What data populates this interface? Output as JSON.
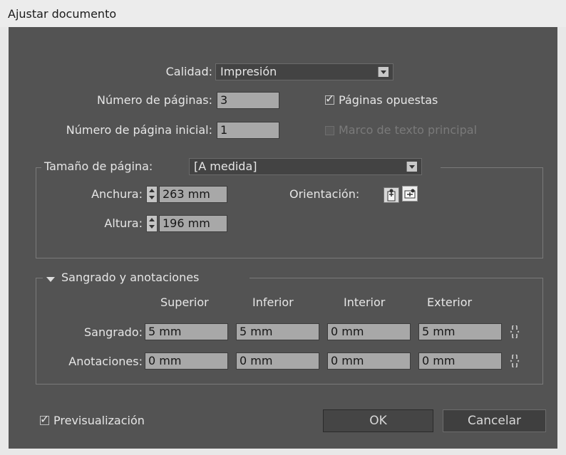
{
  "window": {
    "title": "Ajustar documento"
  },
  "general": {
    "quality_label": "Calidad:",
    "quality_value": "Impresión",
    "num_pages_label": "Número de páginas:",
    "num_pages_value": "3",
    "start_page_label": "Número de página inicial:",
    "start_page_value": "1",
    "facing_pages": {
      "label": "Páginas opuestas",
      "checked": true
    },
    "primary_text_frame": {
      "label": "Marco de texto principal",
      "checked": false,
      "enabled": false
    }
  },
  "page_size": {
    "label": "Tamaño de página:",
    "value": "[A medida]",
    "width_label": "Anchura:",
    "width_value": "263 mm",
    "height_label": "Altura:",
    "height_value": "196 mm",
    "orientation_label": "Orientación:",
    "orientation_selected": "landscape"
  },
  "bleed_slug": {
    "section_label": "Sangrado y anotaciones",
    "columns": [
      "Superior",
      "Inferior",
      "Interior",
      "Exterior"
    ],
    "rows": [
      {
        "label": "Sangrado:",
        "values": [
          "5 mm",
          "5 mm",
          "0 mm",
          "5 mm"
        ]
      },
      {
        "label": "Anotaciones:",
        "values": [
          "0 mm",
          "0 mm",
          "0 mm",
          "0 mm"
        ]
      }
    ]
  },
  "footer": {
    "preview": {
      "label": "Previsualización",
      "checked": true
    },
    "ok_label": "OK",
    "cancel_label": "Cancelar"
  },
  "icons": {
    "checkmark": "✓",
    "link": "chain-link-icon"
  }
}
